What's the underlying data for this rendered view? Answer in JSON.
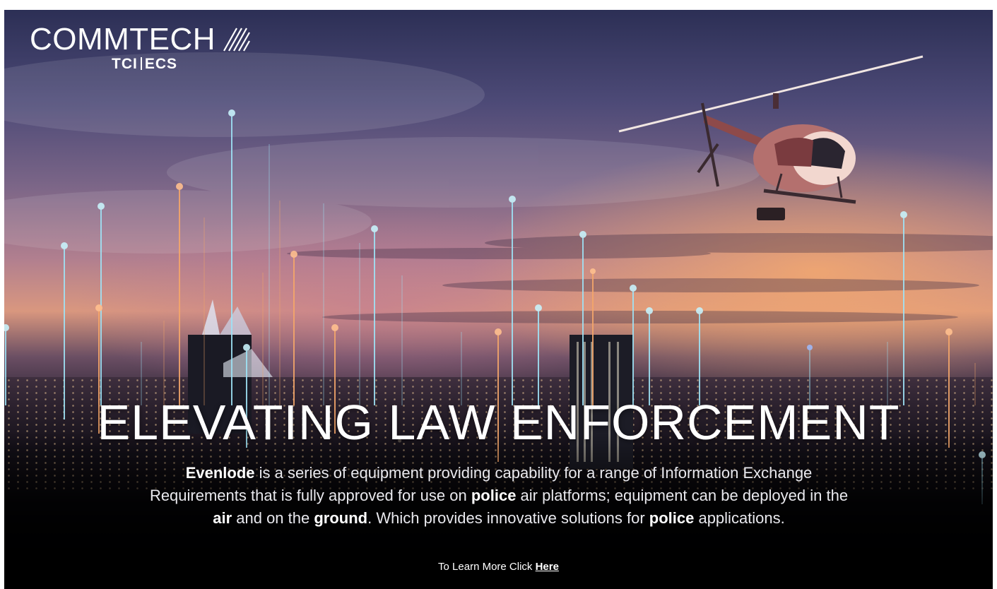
{
  "brand": {
    "name": "COMMTECH",
    "sub_left": "TCI",
    "sub_right": "ECS"
  },
  "headline": "ELEVATING LAW ENFORCEMENT",
  "body": {
    "evenlode": "Evenlode",
    "part1": " is a series of equipment providing capability for a range of Information Exchange Requirements that is fully approved for use on ",
    "police1": "police",
    "part2": " air platforms; equipment can be deployed in the ",
    "air": "air",
    "part3": " and on the ",
    "ground": "ground",
    "part4": ". Which provides innovative solutions for ",
    "police2": "police",
    "part5": " applications."
  },
  "cta": {
    "prefix": "To Learn More Click ",
    "link": "Here"
  },
  "colors": {
    "pole_blue": "#9fe3f5",
    "pole_orange": "#f4a66a"
  }
}
